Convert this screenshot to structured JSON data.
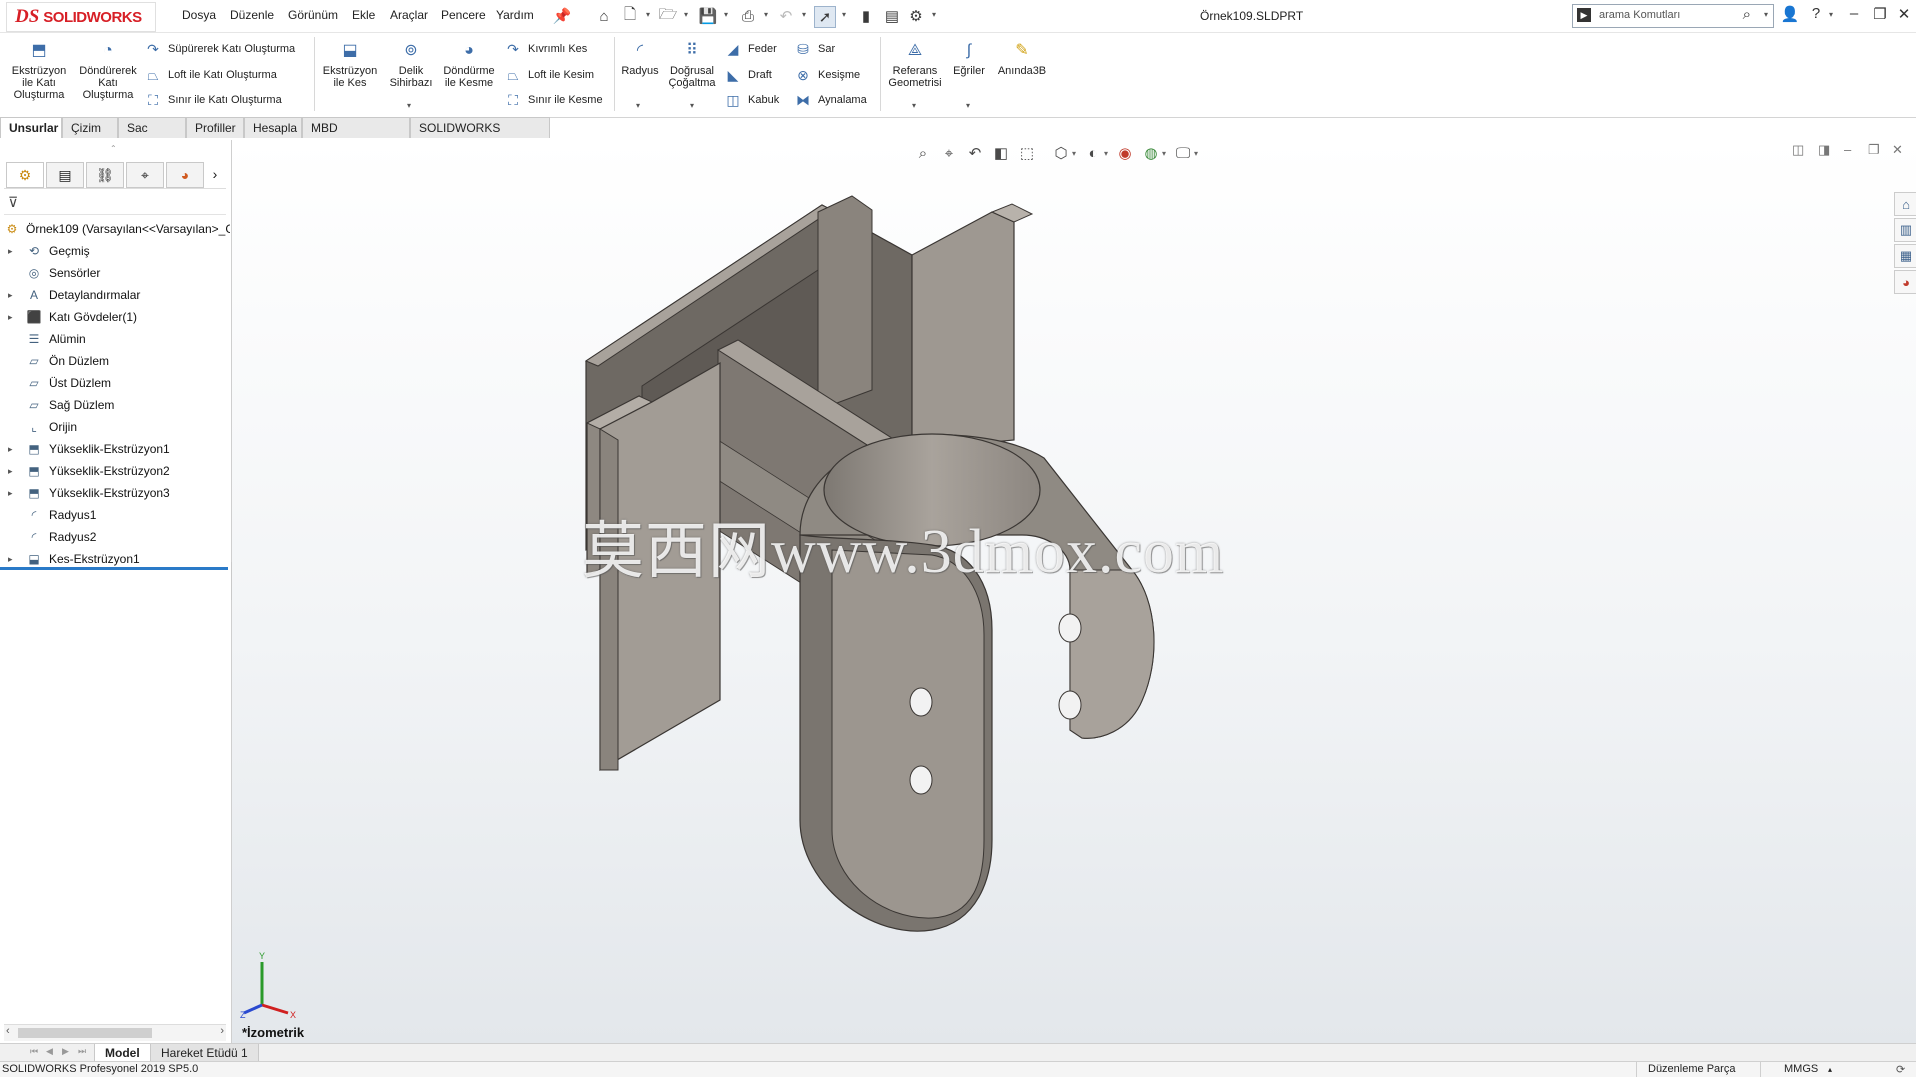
{
  "app": {
    "brand_ds": "DS",
    "brand_name": "SOLIDWORKS",
    "document_title": "Örnek109.SLDPRT"
  },
  "menu": [
    "Dosya",
    "Düzenle",
    "Görünüm",
    "Ekle",
    "Araçlar",
    "Pencere",
    "Yardım"
  ],
  "search": {
    "placeholder": "arama Komutları"
  },
  "ribbon": {
    "extrude_boss": "Ekstrüzyon\nile Katı\nOluşturma",
    "revolve_boss": "Döndürerek\nKatı\nOluşturma",
    "swept_boss": "Süpürerek Katı Oluşturma",
    "loft_boss": "Loft ile Katı Oluşturma",
    "boundary_boss": "Sınır ile Katı Oluşturma",
    "extrude_cut": "Ekstrüzyon\nile Kes",
    "hole_wizard": "Delik\nSihirbazı",
    "revolve_cut": "Döndürme\nile Kesme",
    "swept_cut": "Kıvrımlı Kes",
    "loft_cut": "Loft ile Kesim",
    "boundary_cut": "Sınır ile Kesme",
    "fillet": "Radyus",
    "linear_pattern": "Doğrusal\nÇoğaltma",
    "rib": "Feder",
    "draft": "Draft",
    "shell": "Kabuk",
    "wrap": "Sar",
    "intersect": "Kesişme",
    "mirror": "Aynalama",
    "ref_geometry": "Referans\nGeometrisi",
    "curves": "Eğriler",
    "instant3d": "Anında3B"
  },
  "tabs": [
    "Unsurlar",
    "Çizim",
    "Sac Levha",
    "Profiller",
    "Hesapla",
    "MBD Dimensions",
    "SOLIDWORKS Eklentileri"
  ],
  "tree": {
    "root": "Örnek109  (Varsayılan<<Varsayılan>_G",
    "items": [
      {
        "label": "Geçmiş",
        "icon": "history-icon"
      },
      {
        "label": "Sensörler",
        "icon": "sensor-icon"
      },
      {
        "label": "Detaylandırmalar",
        "icon": "annotation-icon"
      },
      {
        "label": "Katı Gövdeler(1)",
        "icon": "solid-bodies-icon"
      },
      {
        "label": "Alümin",
        "icon": "material-icon"
      },
      {
        "label": "Ön Düzlem",
        "icon": "plane-icon"
      },
      {
        "label": "Üst Düzlem",
        "icon": "plane-icon"
      },
      {
        "label": "Sağ Düzlem",
        "icon": "plane-icon"
      },
      {
        "label": "Orijin",
        "icon": "origin-icon"
      },
      {
        "label": "Yükseklik-Ekstrüzyon1",
        "icon": "extrude-feature-icon"
      },
      {
        "label": "Yükseklik-Ekstrüzyon2",
        "icon": "extrude-feature-icon"
      },
      {
        "label": "Yükseklik-Ekstrüzyon3",
        "icon": "extrude-feature-icon"
      },
      {
        "label": "Radyus1",
        "icon": "fillet-feature-icon"
      },
      {
        "label": "Radyus2",
        "icon": "fillet-feature-icon"
      },
      {
        "label": "Kes-Ekstrüzyon1",
        "icon": "cut-extrude-feature-icon"
      }
    ]
  },
  "viewport": {
    "view_label": "*İzometrik",
    "watermark": "莫西网www.3dmox.com"
  },
  "bottom_tabs": [
    "Model",
    "Hareket Etüdü 1"
  ],
  "status": {
    "product": "SOLIDWORKS Profesyonel 2019 SP5.0",
    "mode": "Düzenleme Parça",
    "units": "MMGS"
  },
  "colors": {
    "brand": "#d71f26",
    "part_face_light": "#a8a29b",
    "part_face_mid": "#8a847d",
    "part_face_dark": "#6e6963",
    "rollback_bar": "#2a7ac8"
  }
}
